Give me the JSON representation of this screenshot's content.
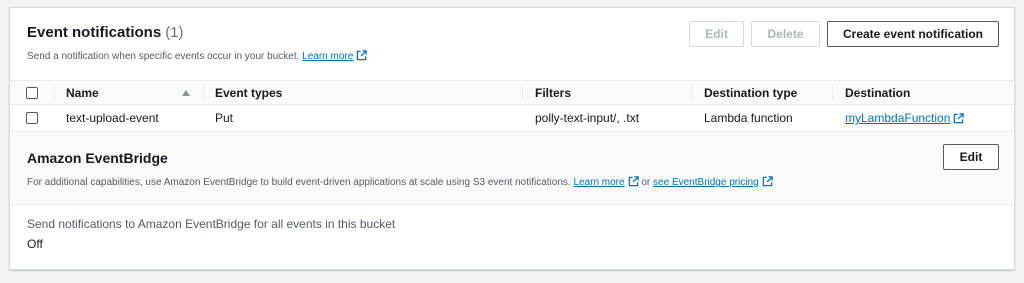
{
  "notifications": {
    "title": "Event notifications",
    "count": "(1)",
    "description": "Send a notification when specific events occur in your bucket.",
    "learn_more": "Learn more",
    "edit_label": "Edit",
    "delete_label": "Delete",
    "create_label": "Create event notification",
    "columns": [
      "Name",
      "Event types",
      "Filters",
      "Destination type",
      "Destination"
    ],
    "rows": [
      {
        "name": "text-upload-event",
        "event_types": "Put",
        "filters": "polly-text-input/, .txt",
        "destination_type": "Lambda function",
        "destination": "myLambdaFunction"
      }
    ]
  },
  "eventbridge": {
    "title": "Amazon EventBridge",
    "edit_label": "Edit",
    "description": "For additional capabilities, use Amazon EventBridge to build event-driven applications at scale using S3 event notifications.",
    "learn_more": "Learn more",
    "or_text": "or",
    "pricing_link": "see EventBridge pricing",
    "setting_label": "Send notifications to Amazon EventBridge for all events in this bucket",
    "setting_value": "Off"
  },
  "colors": {
    "link": "#0073bb",
    "border": "#d5dbdb",
    "text": "#16191f"
  }
}
